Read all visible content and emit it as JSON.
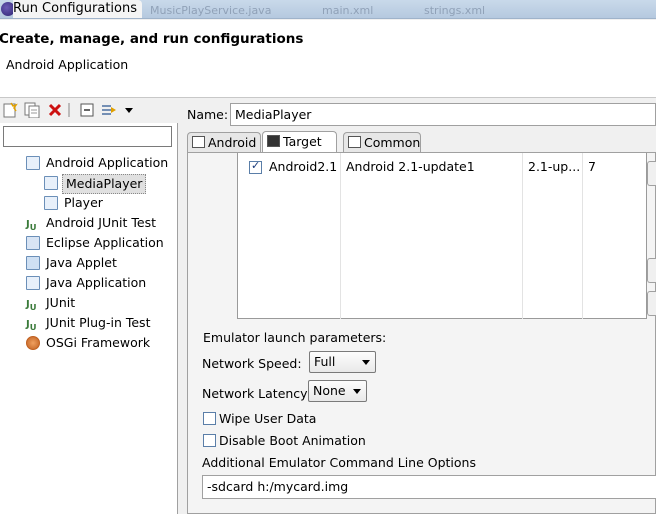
{
  "window": {
    "title": "Run Configurations",
    "background_tabs": [
      "MusicPlayService.java",
      "main.xml",
      "strings.xml"
    ]
  },
  "header": {
    "title": "Create, manage, and run configurations",
    "subtitle": "Android Application"
  },
  "sidebar": {
    "filter_placeholder": "",
    "toolbar_icons": [
      "new-config-icon",
      "duplicate-icon",
      "delete-icon",
      "collapse-all-icon",
      "filter-icon",
      "dropdown-icon"
    ],
    "tree": [
      {
        "label": "Android Application",
        "icon": "android-app-icon",
        "level": 0
      },
      {
        "label": "MediaPlayer",
        "icon": "android-config-icon",
        "level": 1,
        "selected": true
      },
      {
        "label": "Player",
        "icon": "android-config-icon",
        "level": 1
      },
      {
        "label": "Android JUnit Test",
        "icon": "android-junit-icon",
        "level": 0
      },
      {
        "label": "Eclipse Application",
        "icon": "eclipse-app-icon",
        "level": 0
      },
      {
        "label": "Java Applet",
        "icon": "java-applet-icon",
        "level": 0
      },
      {
        "label": "Java Application",
        "icon": "java-app-icon",
        "level": 0
      },
      {
        "label": "JUnit",
        "icon": "junit-icon",
        "level": 0
      },
      {
        "label": "JUnit Plug-in Test",
        "icon": "junit-plugin-icon",
        "level": 0
      },
      {
        "label": "OSGi Framework",
        "icon": "osgi-icon",
        "level": 0
      }
    ]
  },
  "config": {
    "name_label": "Name:",
    "name_value": "MediaPlayer",
    "tabs": [
      {
        "label": "Android",
        "icon": "android-tab-icon"
      },
      {
        "label": "Target",
        "icon": "target-tab-icon",
        "active": true
      },
      {
        "label": "Common",
        "icon": "common-tab-icon"
      }
    ],
    "target_table": {
      "rows": [
        {
          "checked": true,
          "name": "Android2.1",
          "target": "Android 2.1-update1",
          "platform": "2.1-up...",
          "api": "7"
        }
      ]
    },
    "emulator": {
      "group_label": "Emulator launch parameters:",
      "network_speed_label": "Network Speed:",
      "network_speed_value": "Full",
      "network_latency_label": "Network Latency:",
      "network_latency_value": "None",
      "wipe_user_data_label": "Wipe User Data",
      "wipe_user_data_checked": false,
      "disable_boot_animation_label": "Disable Boot Animation",
      "disable_boot_animation_checked": false,
      "additional_options_label": "Additional Emulator Command Line Options",
      "additional_options_value": "-sdcard h:/mycard.img"
    }
  },
  "colors": {
    "header_bg": "#ffffff",
    "panel_bg": "#f0f0f0",
    "delete_red": "#cc1010",
    "selection_bg": "#e0e0e0"
  }
}
